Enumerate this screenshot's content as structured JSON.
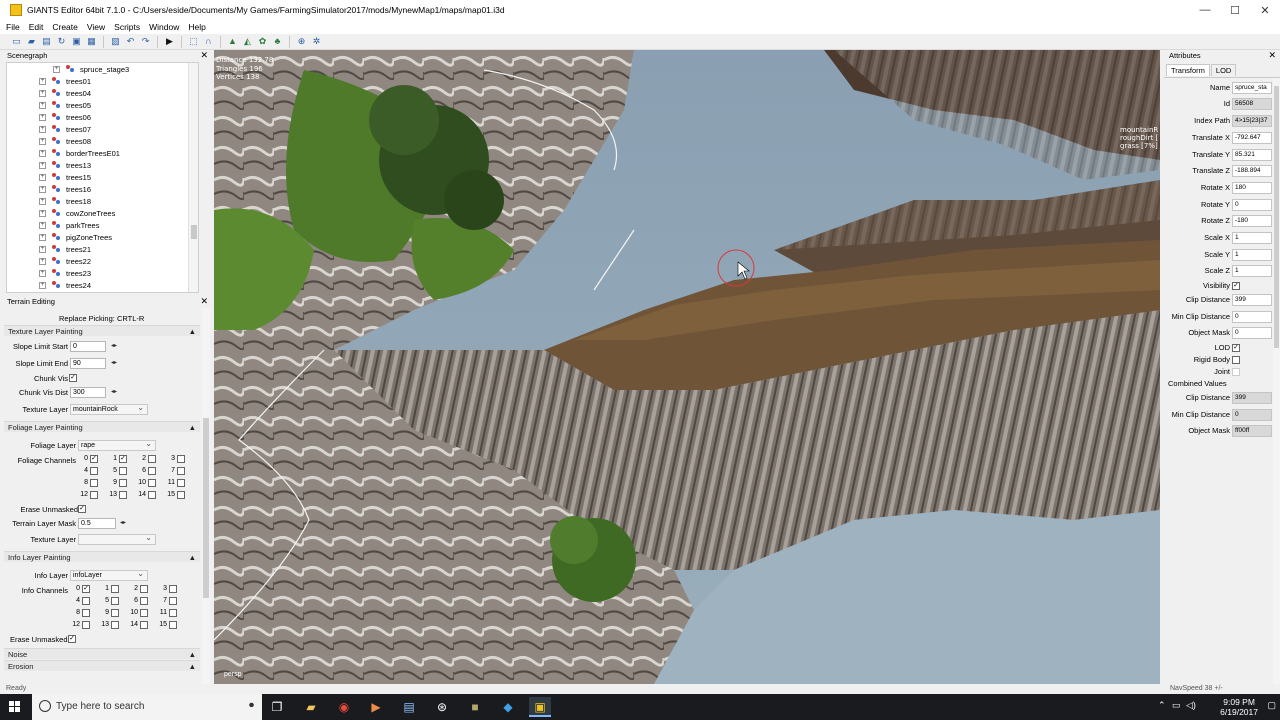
{
  "window": {
    "title": "GIANTS Editor 64bit 7.1.0 - C:/Users/eside/Documents/My Games/FarmingSimulator2017/mods/MynewMap1/maps/map01.i3d",
    "controls": [
      "—",
      "☐",
      "✕"
    ]
  },
  "menu": [
    "File",
    "Edit",
    "Create",
    "View",
    "Scripts",
    "Window",
    "Help"
  ],
  "scenegraph": {
    "title": "Scenegraph",
    "items": [
      "spruce_stage3",
      "trees01",
      "trees04",
      "trees05",
      "trees06",
      "trees07",
      "trees08",
      "borderTreesE01",
      "trees13",
      "trees15",
      "trees16",
      "trees18",
      "cowZoneTrees",
      "parkTrees",
      "pigZoneTrees",
      "trees21",
      "trees22",
      "trees23",
      "trees24"
    ]
  },
  "terrain": {
    "title": "Terrain Editing",
    "replace_picking": "Replace Picking: CRTL-R",
    "texture_section": "Texture Layer Painting",
    "slope_start_label": "Slope Limit Start",
    "slope_start_value": "0",
    "slope_end_label": "Slope Limit End",
    "slope_end_value": "90",
    "chunk_vis_label": "Chunk Vis",
    "chunk_vis_dist_label": "Chunk Vis Dist",
    "chunk_vis_dist_value": "300",
    "texture_layer_label": "Texture Layer",
    "texture_layer_value": "mountainRock",
    "foliage_section": "Foliage Layer Painting",
    "foliage_layer_label": "Foliage Layer",
    "foliage_layer_value": "rape",
    "foliage_channels_label": "Foliage Channels",
    "channels": [
      "0",
      "1",
      "2",
      "3",
      "4",
      "5",
      "6",
      "7",
      "8",
      "9",
      "10",
      "11",
      "12",
      "13",
      "14",
      "15"
    ],
    "erase_unmasked_label": "Erase Unmasked",
    "terrain_mask_label": "Terrain Layer Mask",
    "terrain_mask_value": "0.5",
    "texture_layer2_label": "Texture Layer",
    "info_section": "Info Layer Painting",
    "info_layer_label": "Info Layer",
    "info_layer_value": "infoLayer",
    "info_channels_label": "Info Channels",
    "noise_section": "Noise",
    "erosion_section": "Erosion"
  },
  "viewport": {
    "stats": [
      "Distance 132.78",
      "Triangles 196",
      "Vertices 138"
    ],
    "lod_info": [
      "mountainR",
      "roughDirt [",
      "grass [7%]"
    ],
    "camera": "persp"
  },
  "attributes": {
    "title": "Attributes",
    "tabs": [
      "Transform",
      "LOD"
    ],
    "name_label": "Name",
    "name_value": "spruce_sta",
    "id_label": "Id",
    "id_value": "56508",
    "index_label": "Index Path",
    "index_value": "4>15|23|37",
    "tx_label": "Translate X",
    "tx_value": "-792.647",
    "ty_label": "Translate Y",
    "ty_value": "85.321",
    "tz_label": "Translate Z",
    "tz_value": "-188.894",
    "rx_label": "Rotate X",
    "rx_value": "180",
    "ry_label": "Rotate Y",
    "ry_value": "0",
    "rz_label": "Rotate Z",
    "rz_value": "-180",
    "sx_label": "Scale X",
    "sx_value": "1",
    "sy_label": "Scale Y",
    "sy_value": "1",
    "sz_label": "Scale Z",
    "sz_value": "1",
    "visibility_label": "Visibility",
    "clip_label": "Clip Distance",
    "clip_value": "399",
    "minclip_label": "Min Clip Distance",
    "minclip_value": "0",
    "mask_label": "Object Mask",
    "mask_value": "0",
    "lod_label": "LOD",
    "rigid_label": "Rigid Body",
    "joint_label": "Joint",
    "combined_label": "Combined Values",
    "cclip_label": "Clip Distance",
    "cclip_value": "399",
    "cminclip_label": "Min Clip Distance",
    "cminclip_value": "0",
    "cmask_label": "Object Mask",
    "cmask_value": "ff00ff"
  },
  "status": {
    "left": "Ready",
    "right": "NavSpeed 38 +/-"
  },
  "taskbar": {
    "search_placeholder": "Type here to search",
    "time": "9:09 PM",
    "date": "6/19/2017"
  },
  "colors": {
    "water": "#8ea3b3",
    "taskbar": "#191b1e",
    "accent": "#2b5fa8"
  }
}
